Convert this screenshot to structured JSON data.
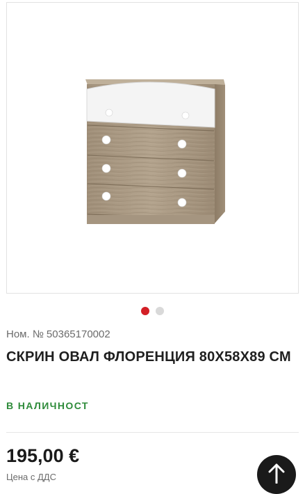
{
  "product": {
    "sku_label": "Ном. №",
    "sku_number": "50365170002",
    "title": "СКРИН ОВАЛ ФЛОРЕНЦИЯ 80Х58Х89 СМ",
    "availability": "В НАЛИЧНОСТ",
    "price": "195,00 €",
    "price_note": "Цена с ДДС"
  },
  "gallery": {
    "slides_total": 2,
    "active_slide": 1,
    "image_subject": "chest of drawers"
  },
  "icons": {
    "scroll_top": "arrow-up-icon"
  },
  "colors": {
    "accent": "#d31f26",
    "availability": "#2e8b3a",
    "dot_inactive": "#d9d9d9",
    "button_bg": "#1a1a1a"
  }
}
